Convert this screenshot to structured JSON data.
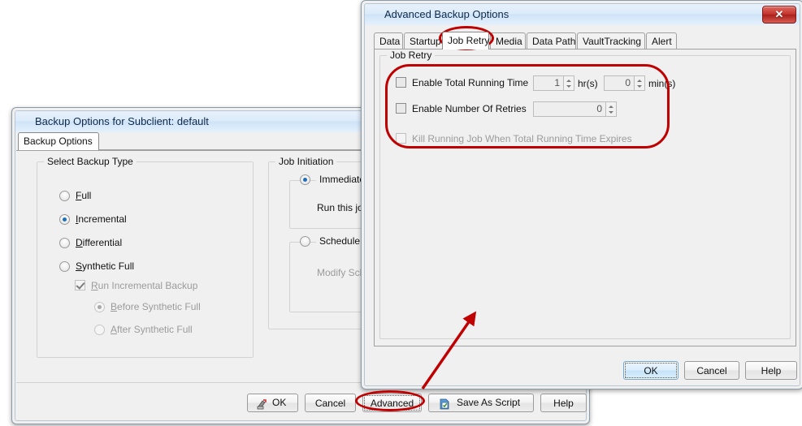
{
  "background_dialog": {
    "title": "Backup Options for Subclient: default",
    "tabs": [
      {
        "label": "Backup Options",
        "selected": true
      }
    ],
    "backup_type_group": {
      "title": "Select Backup Type",
      "options": [
        {
          "label": "Full",
          "mnemonic": "F",
          "selected": false,
          "disabled": false
        },
        {
          "label": "Incremental",
          "mnemonic": "I",
          "selected": true,
          "disabled": false
        },
        {
          "label": "Differential",
          "mnemonic": "D",
          "selected": false,
          "disabled": false
        },
        {
          "label": "Synthetic Full",
          "mnemonic": "S",
          "selected": false,
          "disabled": false
        }
      ],
      "run_incremental_backup": {
        "label": "Run Incremental Backup",
        "mnemonic": "R",
        "checked": true,
        "disabled": true
      },
      "sub_options": [
        {
          "label": "Before Synthetic Full",
          "mnemonic": "B",
          "selected": true,
          "disabled": true
        },
        {
          "label": "After Synthetic Full",
          "mnemonic": "A",
          "selected": false,
          "disabled": true
        }
      ]
    },
    "job_initiation_group": {
      "title": "Job Initiation",
      "immediate": {
        "label": "Immediate",
        "selected": true
      },
      "immediate_text": "Run this job now",
      "schedule": {
        "label": "Schedule",
        "selected": false
      },
      "schedule_text": "Modify Schedule"
    },
    "buttons": [
      {
        "label": "OK",
        "icon": "ok-stamp-icon"
      },
      {
        "label": "Cancel",
        "icon": null
      },
      {
        "label": "Advanced",
        "icon": null,
        "focused": true,
        "highlighted": true
      },
      {
        "label": "Save As Script",
        "icon": "script-icon"
      },
      {
        "label": "Help",
        "icon": null
      }
    ]
  },
  "advanced_dialog": {
    "title": "Advanced Backup Options",
    "close_glyph": "✕",
    "tabs": [
      {
        "label": "Data",
        "selected": false
      },
      {
        "label": "Startup",
        "selected": false
      },
      {
        "label": "Job Retry",
        "selected": true,
        "highlighted": true
      },
      {
        "label": "Media",
        "selected": false
      },
      {
        "label": "Data Path",
        "selected": false
      },
      {
        "label": "VaultTracking",
        "selected": false
      },
      {
        "label": "Alert",
        "selected": false
      }
    ],
    "job_retry_group": {
      "title": "Job Retry",
      "rows": [
        {
          "checkbox": {
            "label": "Enable Total Running Time",
            "checked": false,
            "disabled": false
          },
          "fields": [
            {
              "value": "1",
              "unit": "hr(s)"
            },
            {
              "value": "0",
              "unit": "min(s)"
            }
          ]
        },
        {
          "checkbox": {
            "label": "Enable Number Of Retries",
            "checked": false,
            "disabled": false
          },
          "fields": [
            {
              "value": "0",
              "unit": ""
            }
          ]
        },
        {
          "checkbox": {
            "label": "Kill Running Job When Total Running Time Expires",
            "checked": false,
            "disabled": true
          },
          "fields": []
        }
      ]
    },
    "buttons": [
      {
        "label": "OK",
        "default": true
      },
      {
        "label": "Cancel",
        "default": false
      },
      {
        "label": "Help",
        "default": false
      }
    ]
  },
  "annotations": {
    "accent_color": "#c00000",
    "arrow": {
      "from": "advanced-button",
      "to": "job-retry-panel"
    }
  }
}
